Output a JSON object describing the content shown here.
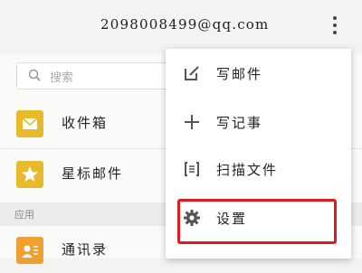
{
  "header": {
    "title": "2098008499@qq.com"
  },
  "search": {
    "placeholder": "搜索"
  },
  "list": {
    "items": [
      {
        "label": "收件箱",
        "icon": "inbox-icon"
      },
      {
        "label": "星标邮件",
        "icon": "star-icon"
      }
    ],
    "section_label": "应用",
    "apps": [
      {
        "label": "通讯录",
        "icon": "contacts-icon"
      }
    ]
  },
  "menu": {
    "items": [
      {
        "label": "写邮件",
        "icon": "compose-icon"
      },
      {
        "label": "写记事",
        "icon": "plus-icon"
      },
      {
        "label": "扫描文件",
        "icon": "scan-icon"
      },
      {
        "label": "设置",
        "icon": "gear-icon"
      }
    ]
  },
  "colors": {
    "highlight": "#e0191f",
    "app_icon": "#e8b92a",
    "contacts_icon": "#f0a030"
  }
}
